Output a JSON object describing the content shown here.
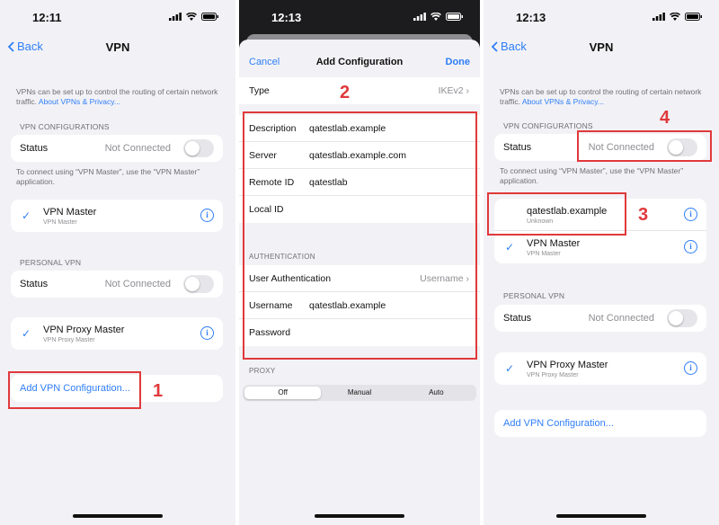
{
  "screen1": {
    "time": "12:11",
    "back_label": "Back",
    "title": "VPN",
    "note_text": "VPNs can be set up to control the routing of certain network traffic.",
    "note_link": "About VPNs & Privacy...",
    "vpn_config_header": "VPN CONFIGURATIONS",
    "status_label": "Status",
    "status_value": "Not Connected",
    "connect_note": "To connect using “VPN Master”, use the “VPN Master” application.",
    "vpn_master_name": "VPN Master",
    "vpn_master_sub": "VPN Master",
    "personal_header": "PERSONAL VPN",
    "personal_status_label": "Status",
    "personal_status_value": "Not Connected",
    "proxy_master_name": "VPN Proxy Master",
    "proxy_master_sub": "VPN Proxy Master",
    "add_vpn_label": "Add VPN Configuration...",
    "marker": "1"
  },
  "screen2": {
    "time": "12:13",
    "cancel_label": "Cancel",
    "title": "Add Configuration",
    "done_label": "Done",
    "type_label": "Type",
    "type_value": "IKEv2",
    "description_label": "Description",
    "description_value": "qatestlab.example",
    "server_label": "Server",
    "server_value": "qatestlab.example.com",
    "remote_id_label": "Remote ID",
    "remote_id_value": "qatestlab",
    "local_id_label": "Local ID",
    "auth_header": "AUTHENTICATION",
    "user_auth_label": "User Authentication",
    "user_auth_value": "Username",
    "username_label": "Username",
    "username_value": "qatestlab.example",
    "password_label": "Password",
    "proxy_header": "PROXY",
    "proxy_options": [
      "Off",
      "Manual",
      "Auto"
    ],
    "proxy_selected": "Off",
    "marker": "2"
  },
  "screen3": {
    "time": "12:13",
    "back_label": "Back",
    "title": "VPN",
    "note_text": "VPNs can be set up to control the routing of certain network traffic.",
    "note_link": "About VPNs & Privacy...",
    "vpn_config_header": "VPN CONFIGURATIONS",
    "status_label": "Status",
    "status_value": "Not Connected",
    "connect_note": "To connect using “VPN Master”, use the “VPN Master” application.",
    "new_vpn_name": "qatestlab.example",
    "new_vpn_sub": "Unknown",
    "vpn_master_name": "VPN Master",
    "vpn_master_sub": "VPN Master",
    "personal_header": "PERSONAL VPN",
    "personal_status_label": "Status",
    "personal_status_value": "Not Connected",
    "proxy_master_name": "VPN Proxy Master",
    "proxy_master_sub": "VPN Proxy Master",
    "add_vpn_label": "Add VPN Configuration...",
    "marker_3": "3",
    "marker_4": "4"
  },
  "colors": {
    "accent": "#2f7ef6",
    "annotation": "#e0393b",
    "background": "#f2f2f6"
  },
  "icons": [
    "chevron-left-icon",
    "checkmark-icon",
    "info-icon",
    "signal-icon",
    "wifi-icon",
    "battery-icon",
    "chevron-right-icon"
  ]
}
